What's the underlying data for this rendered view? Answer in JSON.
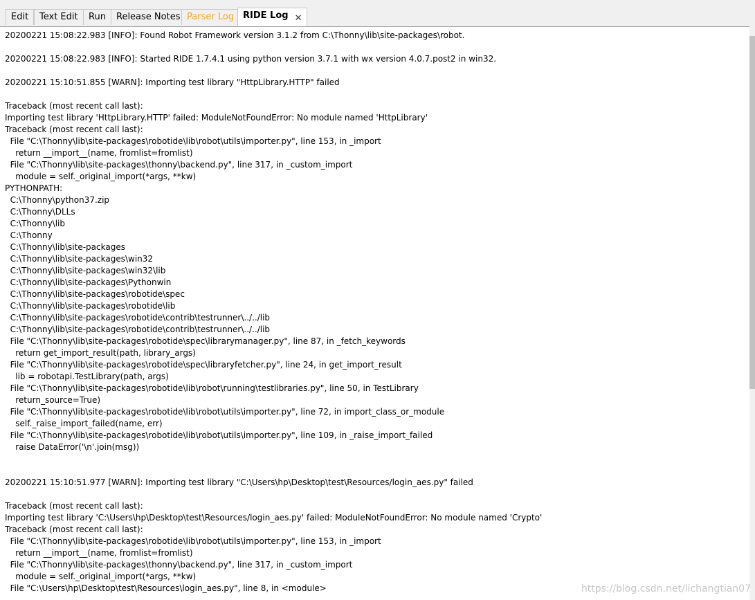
{
  "tabs": [
    {
      "label": "Edit"
    },
    {
      "label": "Text Edit"
    },
    {
      "label": "Run"
    },
    {
      "label": "Release Notes"
    },
    {
      "label": "Parser Log"
    },
    {
      "label": "RIDE Log"
    }
  ],
  "close_glyph": "✕",
  "log_lines": [
    "20200221 15:08:22.983 [INFO]: Found Robot Framework version 3.1.2 from C:\\Thonny\\lib\\site-packages\\robot.",
    "",
    "20200221 15:08:22.983 [INFO]: Started RIDE 1.7.4.1 using python version 3.7.1 with wx version 4.0.7.post2 in win32.",
    "",
    "20200221 15:10:51.855 [WARN]: Importing test library \"HttpLibrary.HTTP\" failed",
    "",
    "Traceback (most recent call last):",
    "Importing test library 'HttpLibrary.HTTP' failed: ModuleNotFoundError: No module named 'HttpLibrary'",
    "Traceback (most recent call last):",
    "  File \"C:\\Thonny\\lib\\site-packages\\robotide\\lib\\robot\\utils\\importer.py\", line 153, in _import",
    "    return __import__(name, fromlist=fromlist)",
    "  File \"C:\\Thonny\\lib\\site-packages\\thonny\\backend.py\", line 317, in _custom_import",
    "    module = self._original_import(*args, **kw)",
    "PYTHONPATH:",
    "  C:\\Thonny\\python37.zip",
    "  C:\\Thonny\\DLLs",
    "  C:\\Thonny\\lib",
    "  C:\\Thonny",
    "  C:\\Thonny\\lib\\site-packages",
    "  C:\\Thonny\\lib\\site-packages\\win32",
    "  C:\\Thonny\\lib\\site-packages\\win32\\lib",
    "  C:\\Thonny\\lib\\site-packages\\Pythonwin",
    "  C:\\Thonny\\lib\\site-packages\\robotide\\spec",
    "  C:\\Thonny\\lib\\site-packages\\robotide\\lib",
    "  C:\\Thonny\\lib\\site-packages\\robotide\\contrib\\testrunner\\../../lib",
    "  C:\\Thonny\\lib\\site-packages\\robotide\\contrib\\testrunner\\../../lib",
    "  File \"C:\\Thonny\\lib\\site-packages\\robotide\\spec\\librarymanager.py\", line 87, in _fetch_keywords",
    "    return get_import_result(path, library_args)",
    "  File \"C:\\Thonny\\lib\\site-packages\\robotide\\spec\\libraryfetcher.py\", line 24, in get_import_result",
    "    lib = robotapi.TestLibrary(path, args)",
    "  File \"C:\\Thonny\\lib\\site-packages\\robotide\\lib\\robot\\running\\testlibraries.py\", line 50, in TestLibrary",
    "    return_source=True)",
    "  File \"C:\\Thonny\\lib\\site-packages\\robotide\\lib\\robot\\utils\\importer.py\", line 72, in import_class_or_module",
    "    self._raise_import_failed(name, err)",
    "  File \"C:\\Thonny\\lib\\site-packages\\robotide\\lib\\robot\\utils\\importer.py\", line 109, in _raise_import_failed",
    "    raise DataError('\\n'.join(msg))",
    "",
    "",
    "20200221 15:10:51.977 [WARN]: Importing test library \"C:\\Users\\hp\\Desktop\\test\\Resources/login_aes.py\" failed",
    "",
    "Traceback (most recent call last):",
    "Importing test library 'C:\\Users\\hp\\Desktop\\test\\Resources/login_aes.py' failed: ModuleNotFoundError: No module named 'Crypto'",
    "Traceback (most recent call last):",
    "  File \"C:\\Thonny\\lib\\site-packages\\robotide\\lib\\robot\\utils\\importer.py\", line 153, in _import",
    "    return __import__(name, fromlist=fromlist)",
    "  File \"C:\\Thonny\\lib\\site-packages\\thonny\\backend.py\", line 317, in _custom_import",
    "    module = self._original_import(*args, **kw)",
    "  File \"C:\\Users\\hp\\Desktop\\test\\Resources\\login_aes.py\", line 8, in <module>"
  ],
  "watermark": "https://blog.csdn.net/lichangtian07"
}
